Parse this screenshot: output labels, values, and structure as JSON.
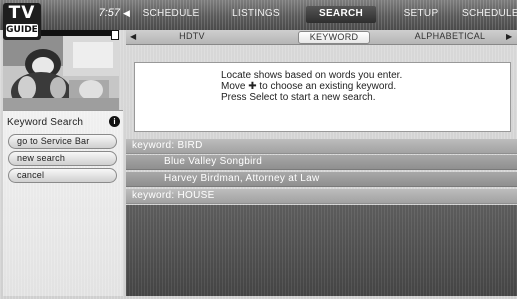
{
  "logo": {
    "line1": "TV",
    "line2": "GUIDE"
  },
  "clock": "7:57",
  "nav": {
    "arrow_left": "◀",
    "items": [
      {
        "label": "SCHEDULE",
        "active": false
      },
      {
        "label": "LISTINGS",
        "active": false
      },
      {
        "label": "SEARCH",
        "active": true
      },
      {
        "label": "SETUP",
        "active": false
      },
      {
        "label": "SCHEDULE",
        "active": false
      }
    ]
  },
  "tabs": {
    "arrow_left": "◀",
    "arrow_right": "▶",
    "items": [
      {
        "label": "HDTV",
        "active": false
      },
      {
        "label": "KEYWORD",
        "active": true
      },
      {
        "label": "ALPHABETICAL",
        "active": false
      }
    ]
  },
  "left_panel": {
    "title": "Keyword Search",
    "info_icon": "i",
    "buttons": [
      {
        "label": "go to Service Bar"
      },
      {
        "label": "new search"
      },
      {
        "label": "cancel"
      }
    ]
  },
  "message": {
    "lines": [
      "Locate shows based on words you enter.",
      "Move ✚ to choose an existing keyword.",
      "Press Select to start a new search."
    ]
  },
  "results": [
    {
      "type": "keyword",
      "text": "keyword: BIRD"
    },
    {
      "type": "show",
      "text": "Blue Valley Songbird"
    },
    {
      "type": "show",
      "text": "Harvey Birdman, Attorney at Law"
    },
    {
      "type": "keyword",
      "text": "keyword: HOUSE"
    }
  ],
  "colors": {
    "top_bar": "#5a5a5a",
    "background": "#d4d4d4",
    "lower_area": "#4f4f4f"
  }
}
